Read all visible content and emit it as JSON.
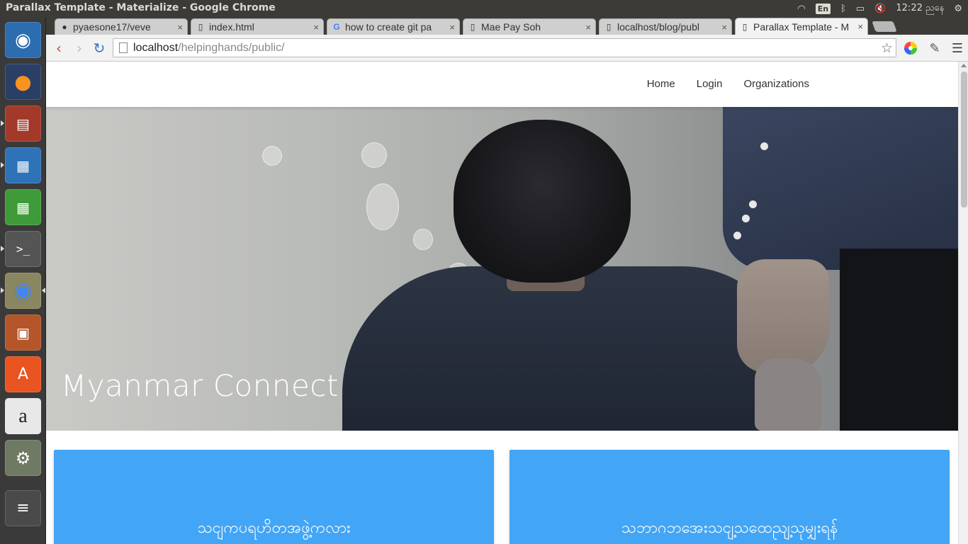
{
  "system": {
    "window_title": "Parallax Template - Materialize - Google Chrome",
    "keyboard": "En",
    "clock": "12:22 ညနေ"
  },
  "launcher": {
    "items": [
      "ubuntu-dash-icon",
      "firefox-icon",
      "files-icon",
      "writer-icon",
      "calc-icon",
      "terminal-icon",
      "chrome-icon",
      "impress-icon",
      "software-center-icon",
      "amazon-icon",
      "system-settings-icon",
      "workspace-switcher-icon"
    ]
  },
  "tabs": [
    {
      "label": "pyaesone17/veve",
      "favicon": "github-icon",
      "close": "×"
    },
    {
      "label": "index.html",
      "favicon": "page-icon",
      "close": "×"
    },
    {
      "label": "how to create git pa",
      "favicon": "google-icon",
      "close": "×"
    },
    {
      "label": "Mae Pay Soh",
      "favicon": "page-icon",
      "close": "×"
    },
    {
      "label": "localhost/blog/publ",
      "favicon": "page-icon",
      "close": "×"
    },
    {
      "label": "Parallax Template - M",
      "favicon": "page-icon",
      "close": "×",
      "active": true
    }
  ],
  "toolbar": {
    "url_host": "localhost",
    "url_path": "/helpinghands/public/"
  },
  "site": {
    "nav": {
      "home": "Home",
      "login": "Login",
      "organizations": "Organizations"
    },
    "hero_title": "Myanmar Connect",
    "cards": [
      {
        "title": "သငျကပရဟိတအဖွဲ့ကလား"
      },
      {
        "title": "သဘာဂဘအေးသငျ့သထေညျ့သုမျှးရန်"
      }
    ]
  },
  "colors": {
    "card_blue": "#42a5f5",
    "ubuntu_panel": "#3c3b37"
  }
}
